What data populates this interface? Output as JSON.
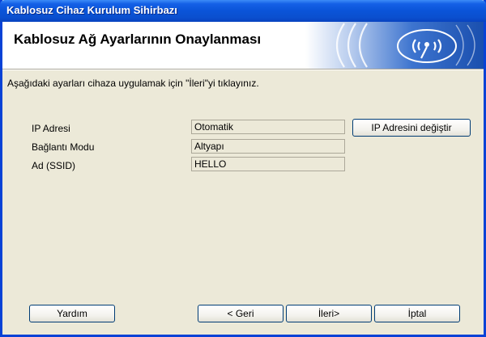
{
  "window": {
    "title": "Kablosuz Cihaz Kurulum Sihirbazı"
  },
  "header": {
    "title": "Kablosuz Ağ Ayarlarının Onaylanması",
    "logo_icon": "wifi-signal-icon"
  },
  "instruction": "Aşağıdaki ayarları cihaza uygulamak için \"İleri\"yi tıklayınız.",
  "fields": [
    {
      "label": "IP Adresi",
      "value": "Otomatik"
    },
    {
      "label": "Bağlantı Modu",
      "value": "Altyapı"
    },
    {
      "label": "Ad (SSID)",
      "value": "HELLO"
    }
  ],
  "buttons": {
    "change_ip": "IP Adresini değiştir",
    "help": "Yardım",
    "back": "< Geri",
    "next": "İleri>",
    "cancel": "İptal"
  },
  "colors": {
    "titlebar": "#0a54d8",
    "header_art": "#1f5fc0",
    "window_bg": "#ece9d8"
  }
}
